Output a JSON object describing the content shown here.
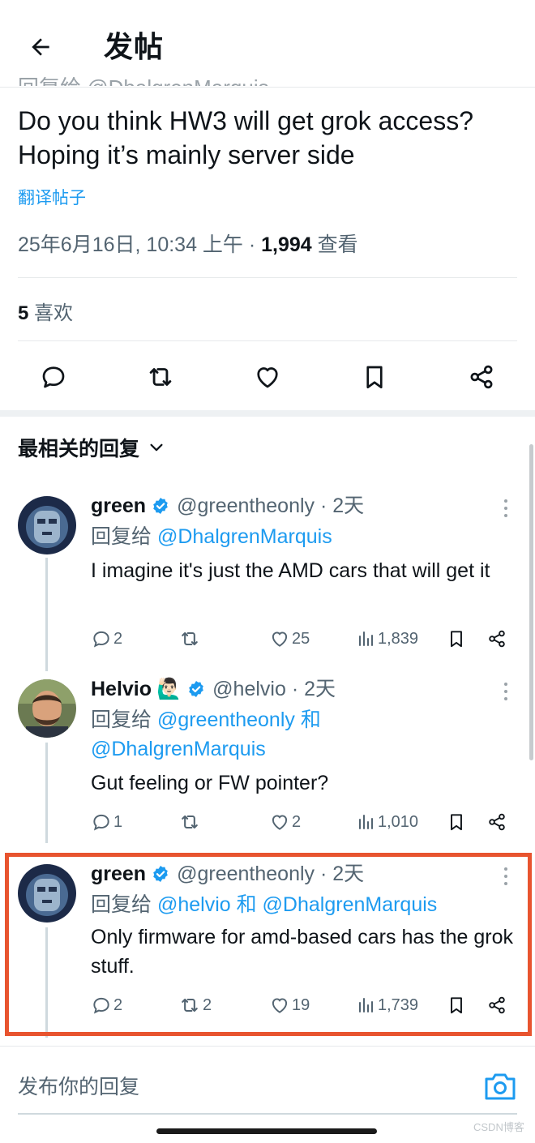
{
  "header": {
    "title": "发帖"
  },
  "post": {
    "cut_text": "回复给 @DhalgrenMarquis",
    "text": "Do you think HW3 will get grok access? Hoping it’s mainly server side",
    "translate_label": "翻译帖子",
    "timestamp": "25年6月16日, 10:34 上午 · ",
    "views_count": "1,994",
    "views_label": " 查看",
    "likes_count": "5",
    "likes_label": " 喜欢"
  },
  "sort": {
    "label": "最相关的回复"
  },
  "replies": [
    {
      "name": "green",
      "emoji": "",
      "handle": "@greentheonly · 2天",
      "reply_prefix": "回复给 ",
      "mentions_text": "@DhalgrenMarquis",
      "text": "I imagine it's just the AMD cars that will get it",
      "replies": "2",
      "reposts": "",
      "likes": "25",
      "views": "1,839"
    },
    {
      "name": "Helvio",
      "emoji": "🙋🏻‍♂️",
      "handle": "@helvio · 2天",
      "reply_prefix": "回复给 ",
      "mentions_text": "@greentheonly 和 @DhalgrenMarquis",
      "text": "Gut feeling or FW pointer?",
      "replies": "1",
      "reposts": "",
      "likes": "2",
      "views": "1,010"
    },
    {
      "name": "green",
      "emoji": "",
      "handle": "@greentheonly · 2天",
      "reply_prefix": "回复给 ",
      "mentions_text": "@helvio 和 @DhalgrenMarquis",
      "text": "Only firmware for amd-based cars has the grok stuff.",
      "replies": "2",
      "reposts": "2",
      "likes": "19",
      "views": "1,739"
    }
  ],
  "compose": {
    "placeholder": "发布你的回复"
  },
  "watermark": "CSDN博客",
  "colors": {
    "link": "#1d9bf0",
    "verified": "#1d9bf0",
    "highlight_border": "#e8542f",
    "text_secondary": "#536471"
  },
  "icons": [
    "back-arrow-icon",
    "reply-icon",
    "repost-icon",
    "like-icon",
    "bookmark-icon",
    "share-icon",
    "views-icon",
    "verified-badge-icon",
    "chevron-down-icon",
    "more-icon",
    "camera-icon"
  ]
}
